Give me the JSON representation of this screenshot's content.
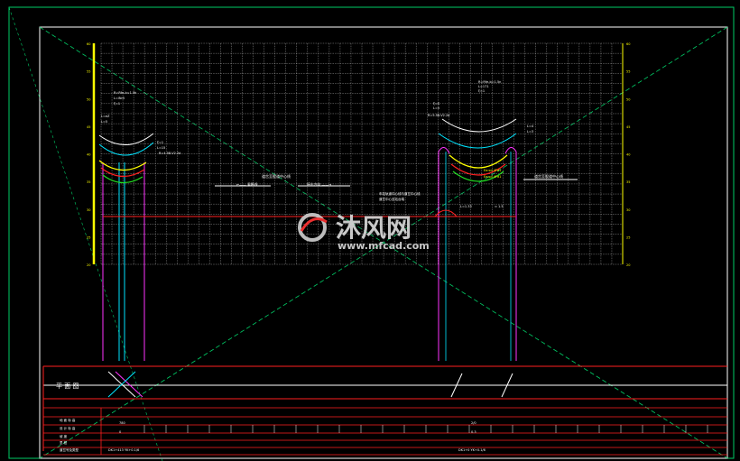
{
  "drawing": {
    "background": "#000000",
    "colors": {
      "frame": "#ffffff",
      "grid": "#d0d0d0",
      "diagonal": "#00cc66",
      "magenta": "#ff33ff",
      "cyan": "#00e5ff",
      "yellow": "#ffff00",
      "red": "#ff2020",
      "green": "#22dd22",
      "orange": "#ff9900",
      "white": "#ffffff"
    },
    "left_scale_labels": [
      "60",
      "55",
      "50",
      "45",
      "40",
      "35",
      "30",
      "25",
      "20"
    ],
    "right_scale_labels": [
      "60",
      "55",
      "50",
      "45",
      "40",
      "35",
      "30",
      "25",
      "20"
    ],
    "left_annotations": {
      "top_block": [
        "R=Rfe-b=1.5h",
        "L=lNr5",
        "ξ=1"
      ],
      "mid_block": [
        "L=eZ",
        "L=5"
      ],
      "curve_note_1": [
        "ξ=1",
        "L=15"
      ],
      "curve_note_2": "R=4.58-V2.2d"
    },
    "right_annotations": {
      "top_block": [
        "R=Rfe-b=1.5n",
        "L=171",
        "ξ=1"
      ],
      "mid_block": [
        "ξ=S",
        "L=5"
      ],
      "curve_note": "R=5.58-V2.2d",
      "side_note": [
        "L=4",
        "L=3"
      ],
      "pipe_note": [
        "Ea:sd 4Fd1",
        "Ea:sd 4Fd1"
      ]
    },
    "center_labels": {
      "left_arrow_label": "←—— 乘降线",
      "left_arrow_label_2": "接出方向 ——→",
      "title_mid": "道岔至股道中心线",
      "right_arrow_label": "道岔至股道中心线",
      "station_note": [
        "车站轨道中心线与道岔中心线",
        "道岔中心至站台端"
      ],
      "station_note_2": "L=1.33",
      "right_station_label": "≈ 1.5"
    },
    "plan_label": "平 面 图",
    "table_rows": [
      "地 面 标 高",
      "设 计 标 高",
      "坡 度",
      "里 程",
      "道岔号及类型"
    ],
    "table_values": {
      "left_top": "780",
      "left_sub": "0",
      "right_top": "2/0",
      "right_sub": "0.3",
      "mid_left_values": [
        "4",
        "2",
        "3",
        "5",
        "4"
      ],
      "mid_right_values": [
        "2",
        "5",
        "6",
        "7"
      ],
      "bottom_left": "DK1+413 YK+0.1/6",
      "bottom_right": "DK1+0 YK+0.1/6"
    },
    "watermark": {
      "brand": "沐风网",
      "url": "www.mfcad.com"
    }
  }
}
